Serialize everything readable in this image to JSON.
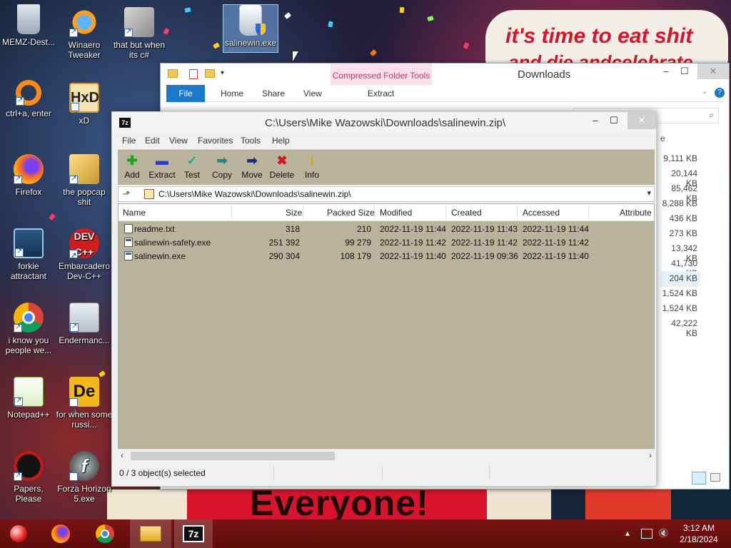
{
  "wallpaper": {
    "sign_top_line1": "it's time to eat shit",
    "sign_top_line2": "and die andcelebrate",
    "sign_bottom": "Everyone!"
  },
  "desktop_icons": [
    {
      "label": "MEMZ-Dest...",
      "icon": "recycle-bin-icon"
    },
    {
      "label": "Winaero Tweaker",
      "icon": "winaero-tweaker-icon"
    },
    {
      "label": "that but when its c#",
      "icon": "windows-stack-icon"
    },
    {
      "label": "salinewin.exe",
      "icon": "salinewin-exe-icon"
    },
    {
      "label": "ctrl+a, enter",
      "icon": "orange-ring-icon"
    },
    {
      "label": "xD",
      "icon": "hxd-editor-icon"
    },
    {
      "label": "Firefox",
      "icon": "firefox-icon"
    },
    {
      "label": "the popcap shit",
      "icon": "popcap-icon"
    },
    {
      "label": "forkie attractant",
      "icon": "forkie-icon"
    },
    {
      "label": "Embarcadero Dev-C++",
      "icon": "dev-cpp-icon"
    },
    {
      "label": "i know you people we...",
      "icon": "chrome-icon"
    },
    {
      "label": "Endermanc...",
      "icon": "endermanch-icon"
    },
    {
      "label": "Notepad++",
      "icon": "notepad-plus-plus-icon"
    },
    {
      "label": "for when some russi...",
      "icon": "de-icon"
    },
    {
      "label": "Papers, Please",
      "icon": "papers-please-icon"
    },
    {
      "label": "Forza Horizon 5.exe",
      "icon": "flash-icon"
    }
  ],
  "explorer": {
    "title": "Downloads",
    "context_tab": "Compressed Folder Tools",
    "ribbon_tabs": [
      "File",
      "Home",
      "Share",
      "View"
    ],
    "context_subtab": "Extract",
    "size_header": "e",
    "sizes": [
      "9,111 KB",
      "20,144 KB",
      "85,462 KB",
      "8,288 KB",
      "436 KB",
      "273 KB",
      "13,342 KB",
      "41,730 KB",
      "204 KB",
      "1,524 KB",
      "1,524 KB",
      "42,222 KB"
    ]
  },
  "zip": {
    "title": "C:\\Users\\Mike Wazowski\\Downloads\\salinewin.zip\\",
    "app_icon_text": "7z",
    "menu": [
      "File",
      "Edit",
      "View",
      "Favorites",
      "Tools",
      "Help"
    ],
    "toolbar": [
      {
        "label": "Add",
        "icon": "add-icon",
        "glyph": "+",
        "color": "#1aa51a"
      },
      {
        "label": "Extract",
        "icon": "extract-icon",
        "glyph": "▬",
        "color": "#2a3fbf"
      },
      {
        "label": "Test",
        "icon": "test-icon",
        "glyph": "✓",
        "color": "#1aa6a6"
      },
      {
        "label": "Copy",
        "icon": "copy-icon",
        "glyph": "➡",
        "color": "#1a8a8a"
      },
      {
        "label": "Move",
        "icon": "move-icon",
        "glyph": "➡",
        "color": "#1a2a8a"
      },
      {
        "label": "Delete",
        "icon": "delete-icon",
        "glyph": "✖",
        "color": "#d41a1a"
      },
      {
        "label": "Info",
        "icon": "info-icon",
        "glyph": "i",
        "color": "#d4a31a"
      }
    ],
    "address": "C:\\Users\\Mike Wazowski\\Downloads\\salinewin.zip\\",
    "columns": [
      "Name",
      "Size",
      "Packed Size",
      "Modified",
      "Created",
      "Accessed",
      "Attribute"
    ],
    "rows": [
      {
        "name": "readme.txt",
        "size": "318",
        "packed": "210",
        "modified": "2022-11-19 11:44",
        "created": "2022-11-19 11:43",
        "accessed": "2022-11-19 11:44",
        "type": "txt"
      },
      {
        "name": "salinewin-safety.exe",
        "size": "251 392",
        "packed": "99 279",
        "modified": "2022-11-19 11:42",
        "created": "2022-11-19 11:42",
        "accessed": "2022-11-19 11:42",
        "type": "exe"
      },
      {
        "name": "salinewin.exe",
        "size": "290 304",
        "packed": "108 179",
        "modified": "2022-11-19 11:40",
        "created": "2022-11-19 09:36",
        "accessed": "2022-11-19 11:40",
        "type": "exe"
      }
    ],
    "status": "0 / 3 object(s) selected"
  },
  "taskbar": {
    "apps": [
      "start-orb-icon",
      "firefox-icon",
      "chrome-icon",
      "file-explorer-icon",
      "7zip-icon"
    ],
    "time": "3:12 AM",
    "date": "2/18/2024"
  }
}
